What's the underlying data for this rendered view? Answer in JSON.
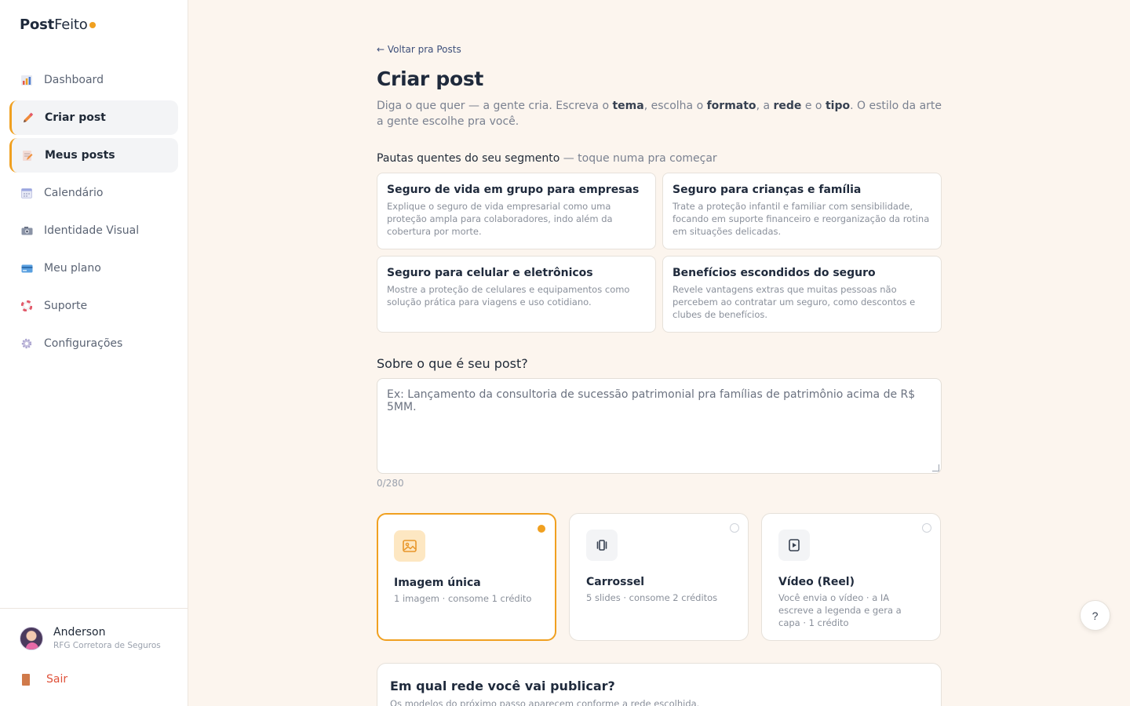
{
  "brand": {
    "name_bold": "Post",
    "name_light": "Feito",
    "accent": "#f0a020"
  },
  "sidebar": {
    "items": [
      {
        "label": "Dashboard",
        "icon": "bar-chart-icon",
        "active": false
      },
      {
        "label": "Criar post",
        "icon": "pencil-icon",
        "active": true
      },
      {
        "label": "Meus posts",
        "icon": "memo-icon",
        "active": true
      },
      {
        "label": "Calendário",
        "icon": "calendar-icon",
        "active": false
      },
      {
        "label": "Identidade Visual",
        "icon": "camera-icon",
        "active": false
      },
      {
        "label": "Meu plano",
        "icon": "credit-card-icon",
        "active": false
      },
      {
        "label": "Suporte",
        "icon": "lifebuoy-icon",
        "active": false
      },
      {
        "label": "Configurações",
        "icon": "gear-icon",
        "active": false
      }
    ],
    "user": {
      "name": "Anderson",
      "company": "RFG Corretora de Seguros"
    },
    "logout_label": "Sair"
  },
  "main": {
    "back_link": "← Voltar pra Posts",
    "title": "Criar post",
    "subtitle": {
      "p1": "Diga o que quer — a gente cria. Escreva o ",
      "b1": "tema",
      "p2": ", escolha o ",
      "b2": "formato",
      "p3": ", a ",
      "b3": "rede",
      "p4": " e o ",
      "b4": "tipo",
      "p5": ". O estilo da arte a gente escolhe pra você."
    },
    "topics_label": "Pautas quentes do seu segmento",
    "topics_hint": " — toque numa pra começar",
    "topics": [
      {
        "title": "Seguro de vida em grupo para empresas",
        "desc": "Explique o seguro de vida empresarial como uma proteção ampla para colaboradores, indo além da cobertura por morte."
      },
      {
        "title": "Seguro para crianças e família",
        "desc": "Trate a proteção infantil e familiar com sensibilidade, focando em suporte financeiro e reorganização da rotina em situações delicadas."
      },
      {
        "title": "Seguro para celular e eletrônicos",
        "desc": "Mostre a proteção de celulares e equipamentos como solução prática para viagens e uso cotidiano."
      },
      {
        "title": "Benefícios escondidos do seguro",
        "desc": "Revele vantagens extras que muitas pessoas não percebem ao contratar um seguro, como descontos e clubes de benefícios."
      }
    ],
    "question": "Sobre o que é seu post?",
    "textarea_placeholder": "Ex: Lançamento da consultoria de sucessão patrimonial pra famílias de patrimônio acima de R$ 5MM.",
    "textarea_value": "",
    "counter": "0/280",
    "formats": [
      {
        "title": "Imagem única",
        "desc": "1 imagem · consome 1 crédito",
        "icon": "image-icon",
        "selected": true
      },
      {
        "title": "Carrossel",
        "desc": "5 slides · consome 2 créditos",
        "icon": "carousel-icon",
        "selected": false
      },
      {
        "title": "Vídeo (Reel)",
        "desc": "Você envia o vídeo · a IA escreve a legenda e gera a capa · 1 crédito",
        "icon": "video-icon",
        "selected": false
      }
    ],
    "network_title": "Em qual rede você vai publicar?",
    "network_desc": "Os modelos do próximo passo aparecem conforme a rede escolhida."
  },
  "help_label": "?"
}
